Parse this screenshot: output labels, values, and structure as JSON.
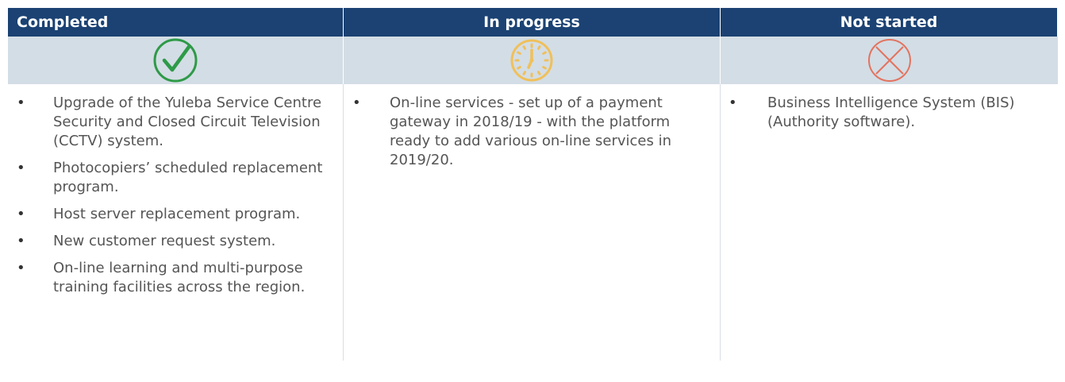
{
  "columns": [
    {
      "header": "Completed",
      "icon": "check-circle-icon",
      "icon_color": "#2e9a48",
      "items": [
        "Upgrade of the Yuleba Service Centre Security and Closed Circuit Television (CCTV) system.",
        "Photocopiers’ scheduled replacement program.",
        "Host server replacement program.",
        "New customer request system.",
        "On-line learning and multi-purpose training facilities across the region."
      ]
    },
    {
      "header": "In progress",
      "icon": "clock-icon",
      "icon_color": "#f0c05a",
      "items": [
        "On-line services - set up of a payment gateway in 2018/19 - with the platform ready to add various on-line services in 2019/20."
      ]
    },
    {
      "header": "Not started",
      "icon": "x-circle-icon",
      "icon_color": "#e3735f",
      "items": [
        "Business Intelligence System (BIS) (Authority software)."
      ]
    }
  ],
  "colors": {
    "header_bg": "#1b4273",
    "icon_row_bg": "#d3dde5"
  }
}
